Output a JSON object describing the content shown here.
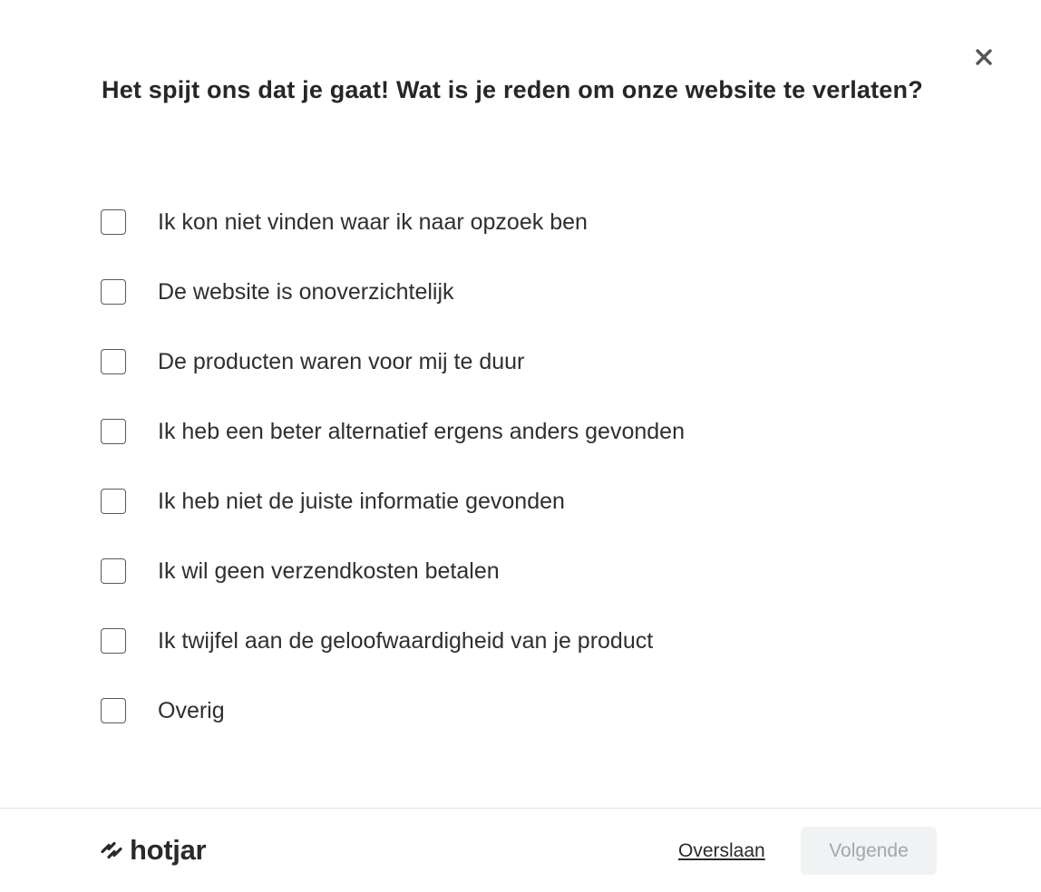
{
  "survey": {
    "question": "Het spijt ons dat je gaat! Wat is je reden om onze website te verlaten?",
    "close_icon": "close-icon",
    "options": [
      {
        "label": "Ik kon niet vinden waar ik naar opzoek ben",
        "checked": false
      },
      {
        "label": "De website is onoverzichtelijk",
        "checked": false
      },
      {
        "label": "De producten waren voor mij te duur",
        "checked": false
      },
      {
        "label": "Ik heb een beter alternatief ergens anders gevonden",
        "checked": false
      },
      {
        "label": "Ik heb niet de juiste informatie gevonden",
        "checked": false
      },
      {
        "label": "Ik wil geen verzendkosten betalen",
        "checked": false
      },
      {
        "label": "Ik twijfel aan de geloofwaardigheid van je product",
        "checked": false
      },
      {
        "label": "Overig",
        "checked": false
      }
    ]
  },
  "footer": {
    "logo_text": "hotjar",
    "logo_icon": "hotjar-logo-icon",
    "skip_label": "Overslaan",
    "next_label": "Volgende",
    "next_enabled": false
  },
  "colors": {
    "text": "#262626",
    "checkbox_border": "#595959",
    "next_button_bg": "#f1f2f4",
    "next_button_text": "#a3a6ab",
    "divider": "#e4e4e4"
  }
}
